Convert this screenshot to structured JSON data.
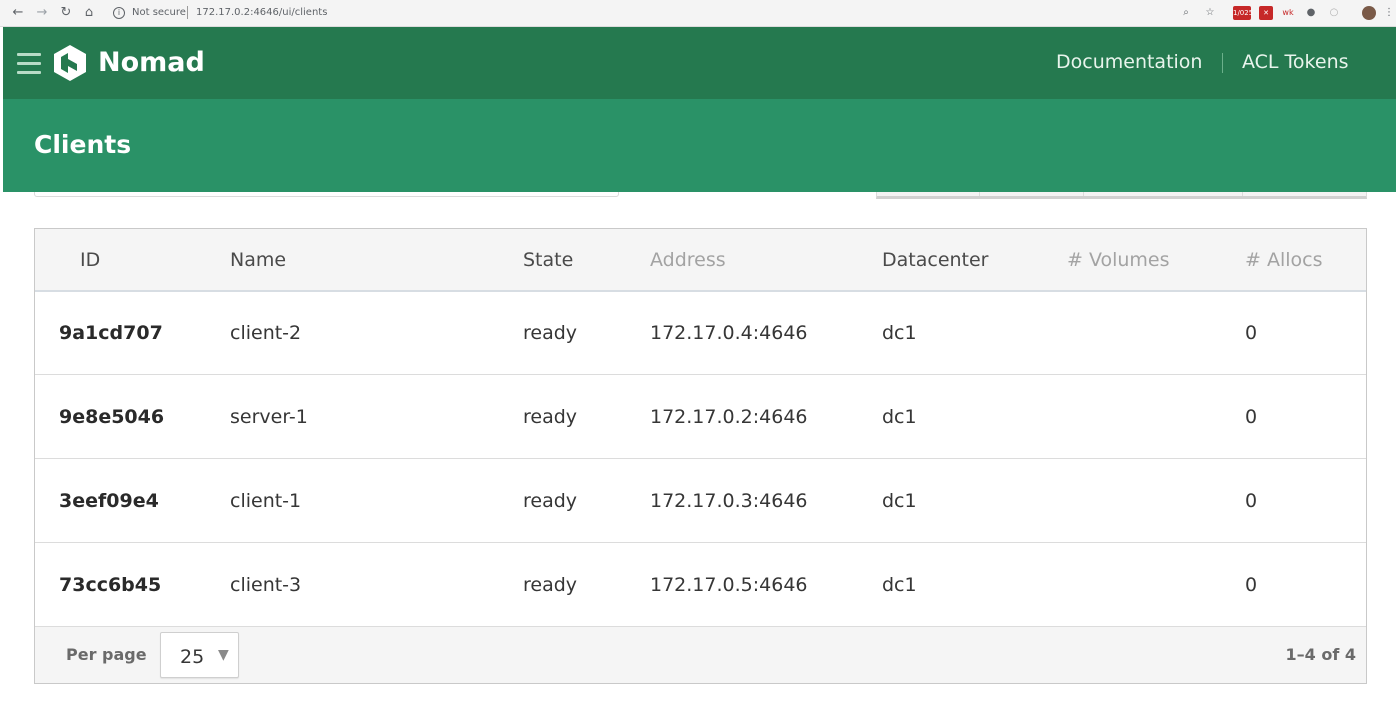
{
  "browser": {
    "security_label": "Not secure",
    "url": "172.17.0.2:4646/ui/clients",
    "extension_badge": "1/025",
    "extension_text": "wk"
  },
  "header": {
    "brand": "Nomad",
    "nav": [
      "Documentation",
      "ACL Tokens"
    ]
  },
  "page": {
    "title": "Clients"
  },
  "table": {
    "columns": [
      "ID",
      "Name",
      "State",
      "Address",
      "Datacenter",
      "# Volumes",
      "# Allocs"
    ],
    "rows": [
      {
        "id": "9a1cd707",
        "name": "client-2",
        "state": "ready",
        "address": "172.17.0.4:4646",
        "datacenter": "dc1",
        "volumes": "",
        "allocs": "0"
      },
      {
        "id": "9e8e5046",
        "name": "server-1",
        "state": "ready",
        "address": "172.17.0.2:4646",
        "datacenter": "dc1",
        "volumes": "",
        "allocs": "0"
      },
      {
        "id": "3eef09e4",
        "name": "client-1",
        "state": "ready",
        "address": "172.17.0.3:4646",
        "datacenter": "dc1",
        "volumes": "",
        "allocs": "0"
      },
      {
        "id": "73cc6b45",
        "name": "client-3",
        "state": "ready",
        "address": "172.17.0.5:4646",
        "datacenter": "dc1",
        "volumes": "",
        "allocs": "0"
      }
    ]
  },
  "pagination": {
    "per_page_label": "Per page",
    "per_page_value": "25",
    "range": "1–4 of 4"
  },
  "colors": {
    "header_dark": "#25794f",
    "header_band": "#2a9267"
  }
}
